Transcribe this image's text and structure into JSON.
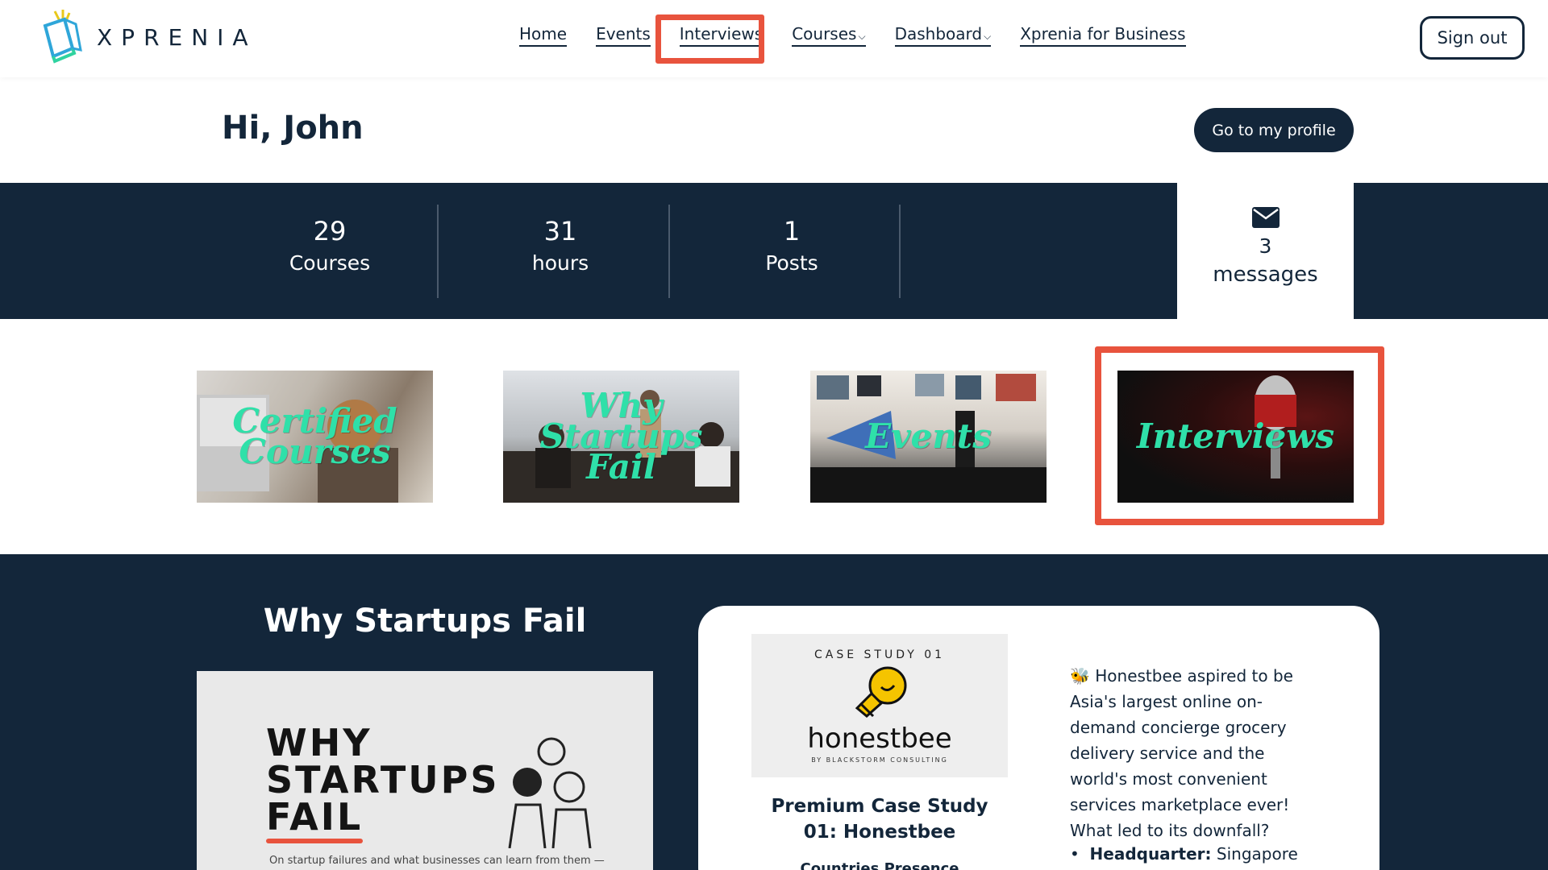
{
  "header": {
    "logo_text": "XPRENIA",
    "nav": [
      {
        "label": "Home",
        "caret": ""
      },
      {
        "label": "Events",
        "caret": ""
      },
      {
        "label": "Interviews",
        "caret": ""
      },
      {
        "label": "Courses",
        "caret": "⌵"
      },
      {
        "label": "Dashboard",
        "caret": "⌵"
      },
      {
        "label": "Xprenia for Business",
        "caret": ""
      }
    ],
    "signout": "Sign out"
  },
  "greeting": {
    "text": "Hi, John",
    "profile_button": "Go to my profile"
  },
  "stats": [
    {
      "value": "29",
      "label": "Courses"
    },
    {
      "value": "31",
      "label": "hours"
    },
    {
      "value": "1",
      "label": "Posts"
    }
  ],
  "messages": {
    "icon": "envelope-icon",
    "count": "3",
    "label": "messages"
  },
  "tiles": [
    {
      "label": "Certified Courses",
      "line1": "Certified",
      "line2": "Courses"
    },
    {
      "label": "Why Startups Fail",
      "line1": "Why",
      "line2": "Startups Fail"
    },
    {
      "label": "Events",
      "line1": "Events",
      "line2": ""
    },
    {
      "label": "Interviews",
      "line1": "Interviews",
      "line2": ""
    }
  ],
  "featured": {
    "title": "Why Startups Fail",
    "image_title": [
      "WHY",
      "STARTUPS",
      "FAIL"
    ],
    "image_caption": "On startup failures and what businesses can learn from them —"
  },
  "case_study": {
    "kicker": "CASE STUDY 01",
    "brand": "honestbee",
    "by": "BY BLACKSTORM CONSULTING",
    "title": "Premium Case Study 01: Honestbee",
    "subheading": "Countries Presence",
    "description": "🐝 Honestbee aspired to be Asia's largest online on-demand concierge grocery delivery service and the world's most convenient services marketplace ever! What led to its downfall?",
    "bullet_label": "Headquarter:",
    "bullet_value": "Singapore"
  },
  "colors": {
    "navy": "#13263a",
    "highlight": "#e8533d",
    "tile_text": "#2fe0a9"
  }
}
